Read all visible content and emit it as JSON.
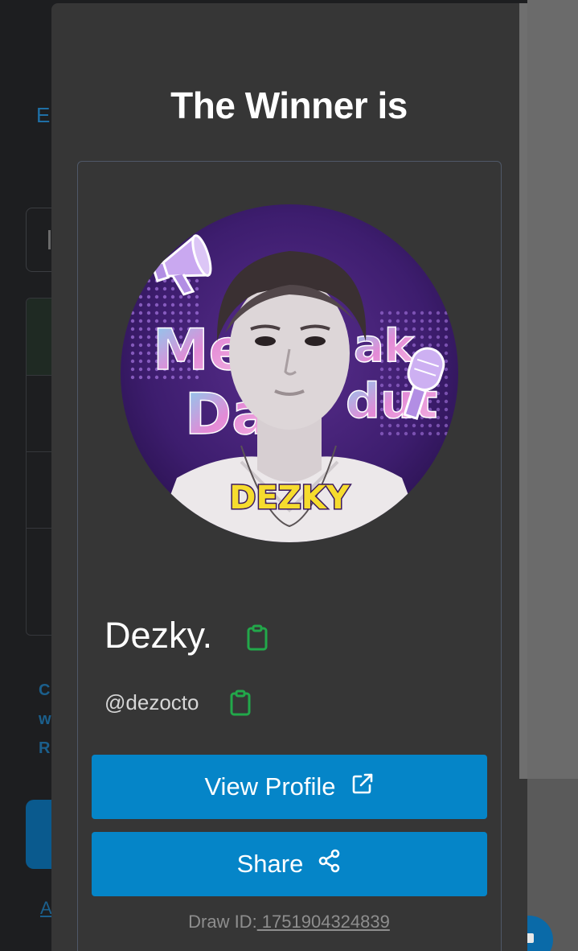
{
  "background": {
    "partial_text_e": "E",
    "partial_letters": [
      "C",
      "w",
      "R"
    ],
    "partial_link": "A"
  },
  "modal": {
    "title": "The Winner is",
    "winner": {
      "display_name": "Dezky.",
      "handle": "@dezocto",
      "avatar_caption": "DEZKY",
      "avatar_bg_text_top": "Me",
      "avatar_bg_text_top_right": "ak",
      "avatar_bg_text_bottom": "Da",
      "avatar_bg_text_bottom_right": "dut"
    },
    "buttons": {
      "view_profile": "View Profile",
      "share": "Share"
    },
    "draw_id_label": "Draw ID:",
    "draw_id_value": " 1751904324839"
  },
  "colors": {
    "modal_bg": "#363636",
    "button_bg": "#0585c8",
    "copy_icon": "#22a84a",
    "card_border": "#4f5868"
  },
  "icons": [
    "copy-icon",
    "external-link-icon",
    "share-icon"
  ]
}
